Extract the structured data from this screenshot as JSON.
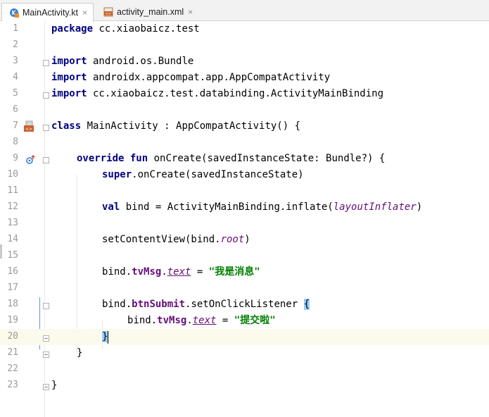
{
  "tabs": [
    {
      "label": "MainActivity.kt",
      "active": true,
      "icon": "kotlin-file-icon"
    },
    {
      "label": "activity_main.xml",
      "active": false,
      "icon": "xml-file-icon"
    }
  ],
  "tab_close_glyph": "×",
  "line_numbers": [
    "1",
    "2",
    "3",
    "4",
    "5",
    "6",
    "7",
    "8",
    "9",
    "10",
    "11",
    "12",
    "13",
    "14",
    "15",
    "16",
    "17",
    "18",
    "19",
    "20",
    "21",
    "22",
    "23"
  ],
  "code": {
    "l1": {
      "kw": "package",
      "rest": " cc.xiaobaicz.test"
    },
    "l3": {
      "kw": "import",
      "rest": " android.os.Bundle"
    },
    "l4": {
      "kw": "import",
      "rest": " androidx.appcompat.app.AppCompatActivity"
    },
    "l5": {
      "kw": "import",
      "rest": " cc.xiaobaicz.test.databinding.ActivityMainBinding"
    },
    "l7": {
      "kw": "class",
      "rest": " MainActivity : AppCompatActivity() {"
    },
    "l9": {
      "kw1": "override",
      "sp": " ",
      "kw2": "fun",
      "rest": " onCreate(savedInstanceState: Bundle?) {"
    },
    "l10": {
      "kw": "super",
      "rest": ".onCreate(savedInstanceState)"
    },
    "l12": {
      "kw": "val",
      "pre": " bind = ActivityMainBinding.inflate(",
      "ital": "layoutInflater",
      "post": ")"
    },
    "l14": {
      "pre": "setContentView(bind.",
      "ital": "root",
      "post": ")"
    },
    "l16": {
      "pre": "bind.",
      "prop": "tvMsg",
      "dot": ".",
      "syn": "text",
      "eq": " = ",
      "str": "\"我是消息\""
    },
    "l18": {
      "pre": "bind.",
      "prop": "btnSubmit",
      "mid": ".setOnClickListener ",
      "brace": "{"
    },
    "l19": {
      "pre": "bind.",
      "prop": "tvMsg",
      "dot": ".",
      "syn": "text",
      "eq": " = ",
      "str": "\"提交啦\""
    },
    "l20": {
      "brace": "}"
    },
    "l21": {
      "text": "}"
    },
    "l23": {
      "text": "}"
    }
  },
  "gutter_icons": {
    "line7": "layout-file-icon",
    "line9": "override-method-icon"
  },
  "colors": {
    "keyword": "#000080",
    "string": "#008000",
    "property": "#660e7a",
    "caret_line": "#fcfaed",
    "brace_match": "#99ccff"
  }
}
